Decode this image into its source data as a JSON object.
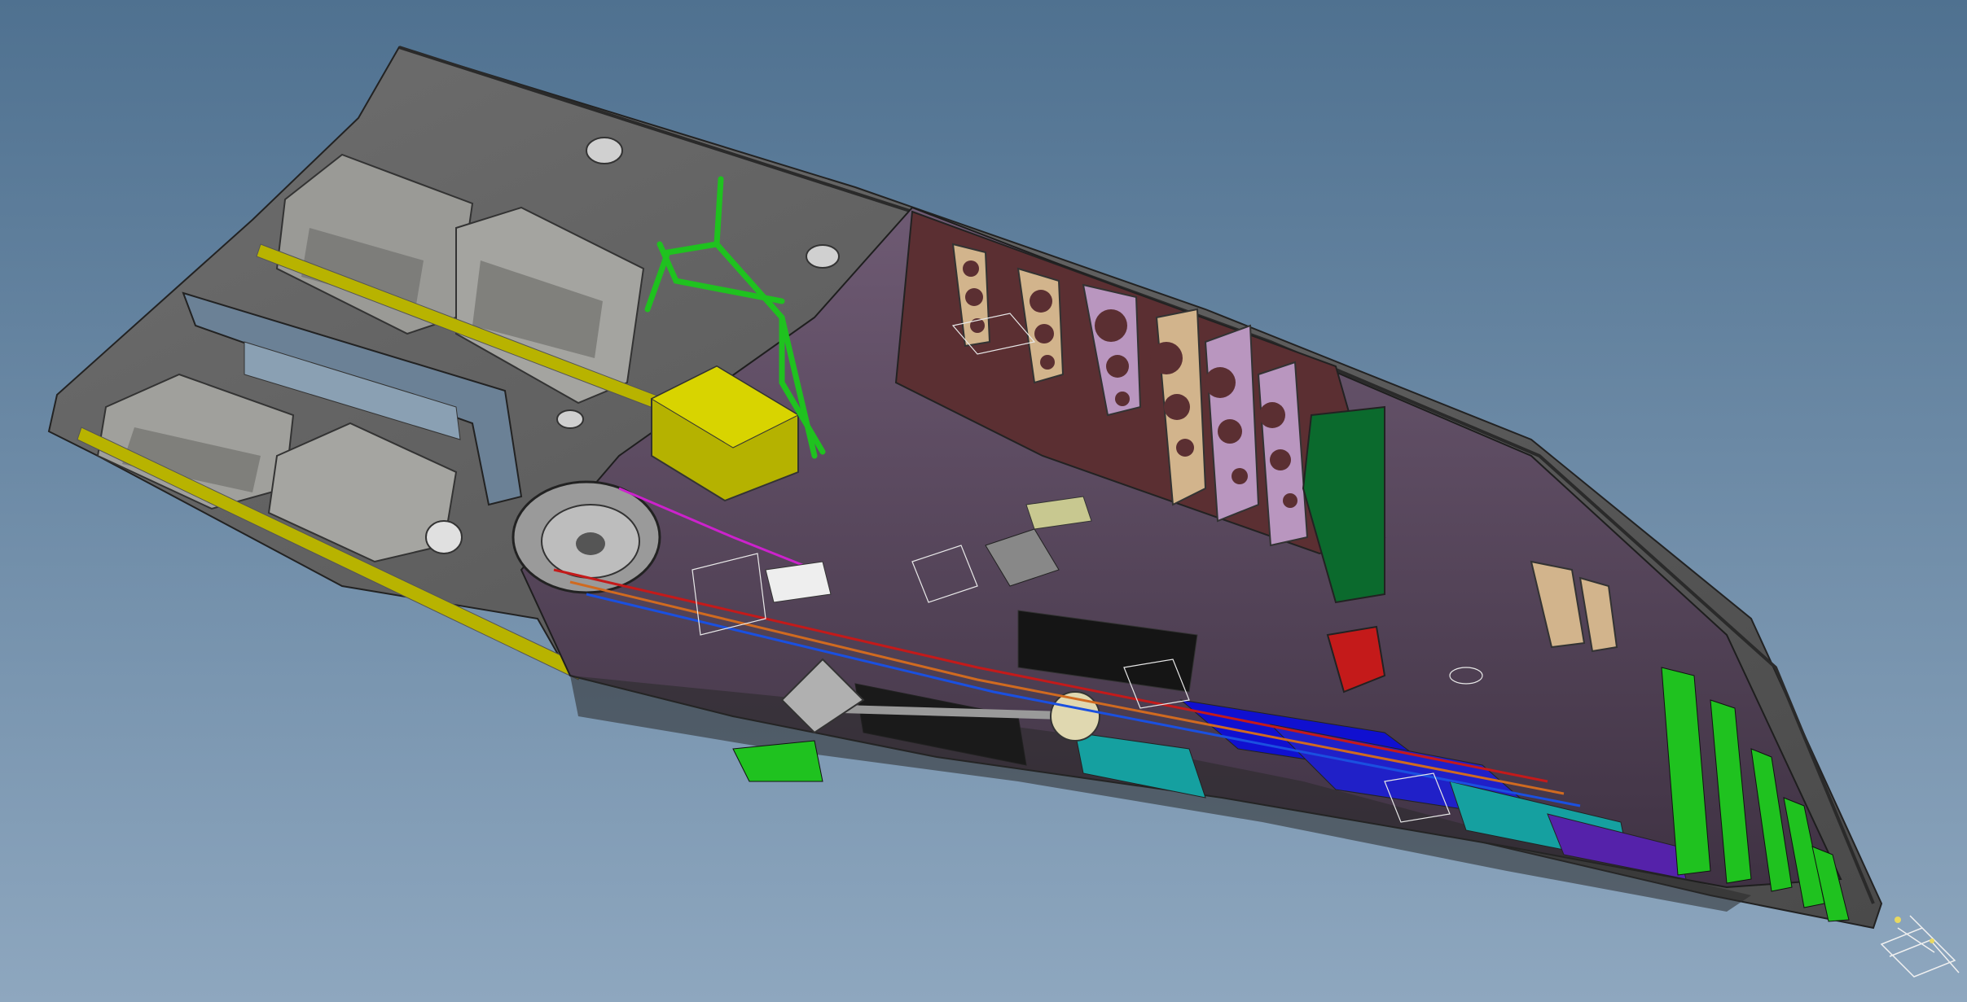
{
  "viewport": {
    "background_top": "#4f7190",
    "background_bottom": "#8ea7bf"
  },
  "model": {
    "hull_color": "#5a5a5a",
    "deck_color": "#707070",
    "bulkhead_color": "#8f6f95",
    "frame_color": "#d2b48c",
    "inner_hull_color": "#5b2f32",
    "accent_colors": [
      "#b5b200",
      "#1fc21f",
      "#1010d0",
      "#15a0a0",
      "#c41a1a",
      "#d06a20",
      "#0b6a2d"
    ]
  },
  "compass": {
    "icon": "compass-axis-icon"
  }
}
